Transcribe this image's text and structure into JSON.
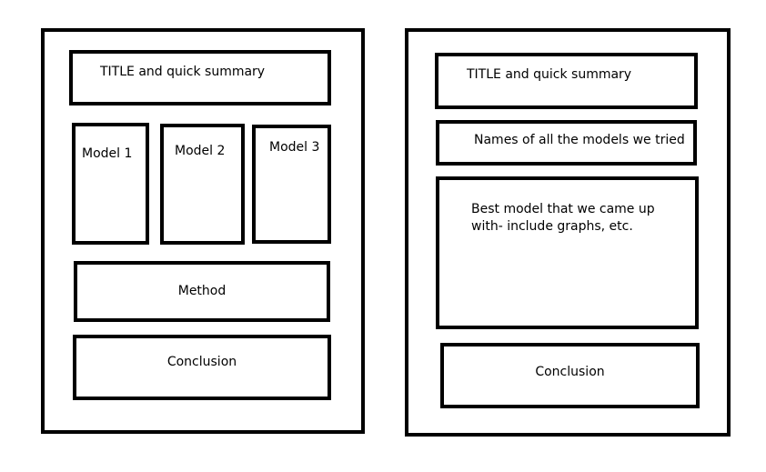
{
  "layout_a": {
    "title_box": "TITLE and quick summary",
    "models": [
      "Model 1",
      "Model 2",
      "Model 3"
    ],
    "method_box": "Method",
    "conclusion_box": "Conclusion"
  },
  "layout_b": {
    "title_box": "TITLE and quick summary",
    "models_box": "Names of all the models we tried",
    "best_model_box": "Best model that we came up with- include graphs, etc.",
    "conclusion_box": "Conclusion"
  }
}
